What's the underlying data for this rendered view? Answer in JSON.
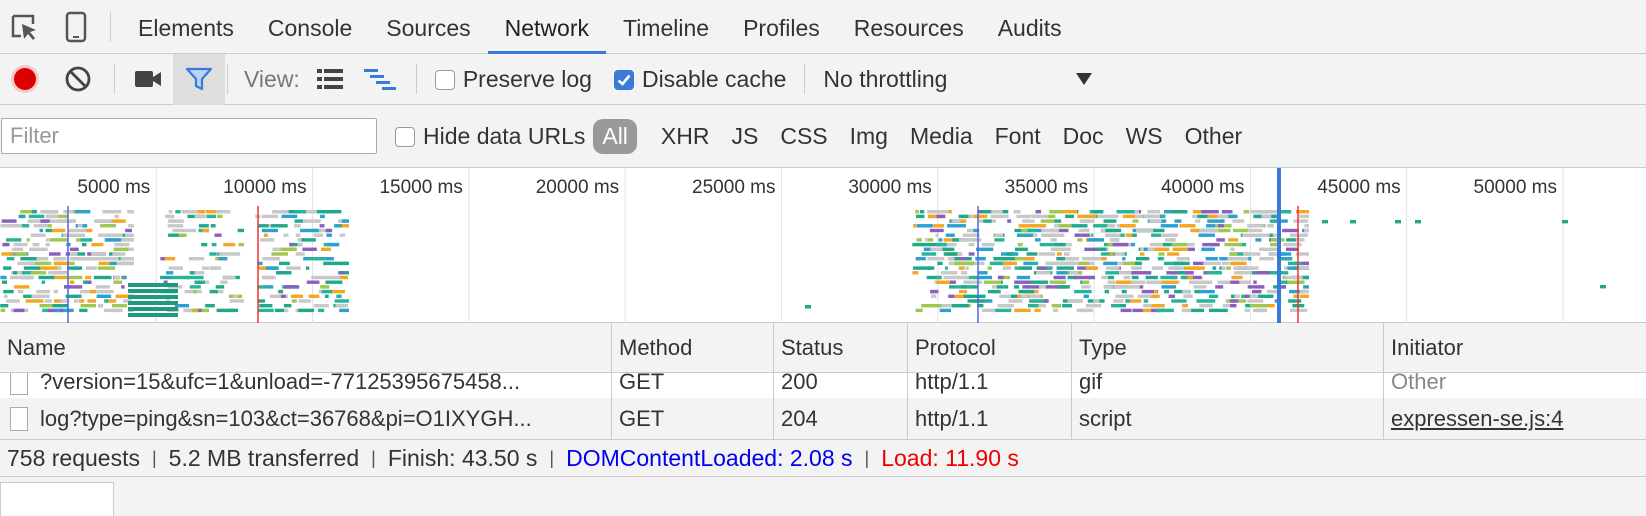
{
  "tabs": [
    "Elements",
    "Console",
    "Sources",
    "Network",
    "Timeline",
    "Profiles",
    "Resources",
    "Audits"
  ],
  "toolbar": {
    "view_label": "View:",
    "preserve_log": "Preserve log",
    "disable_cache": "Disable cache",
    "throttling": "No throttling",
    "preserve_checked": false,
    "disable_cache_checked": true
  },
  "filter": {
    "placeholder": "Filter",
    "hide_data_urls": "Hide data URLs",
    "types": [
      "All",
      "XHR",
      "JS",
      "CSS",
      "Img",
      "Media",
      "Font",
      "Doc",
      "WS",
      "Other"
    ]
  },
  "overview": {
    "ticks": [
      "5000 ms",
      "10000 ms",
      "15000 ms",
      "20000 ms",
      "25000 ms",
      "30000 ms",
      "35000 ms",
      "40000 ms",
      "45000 ms",
      "50000 ms"
    ]
  },
  "columns": [
    "Name",
    "Method",
    "Status",
    "Protocol",
    "Type",
    "Initiator"
  ],
  "rows": [
    {
      "name": "?version=15&ufc=1&unload=-77125395675458...",
      "method": "GET",
      "status": "200",
      "protocol": "http/1.1",
      "type": "gif",
      "initiator": "Other"
    },
    {
      "name": "log?type=ping&sn=103&ct=36768&pi=O1IXYGH...",
      "method": "GET",
      "status": "204",
      "protocol": "http/1.1",
      "type": "script",
      "initiator": "expressen-se.js:4"
    }
  ],
  "status": {
    "requests": "758 requests",
    "transferred": "5.2 MB transferred",
    "finish": "Finish: 43.50 s",
    "dcl": "DOMContentLoaded: 2.08 s",
    "load": "Load: 11.90 s"
  },
  "colors": {
    "accent": "#3879d9",
    "record": "#dd0000",
    "dcl": "#0000ee",
    "load": "#ee0000"
  }
}
